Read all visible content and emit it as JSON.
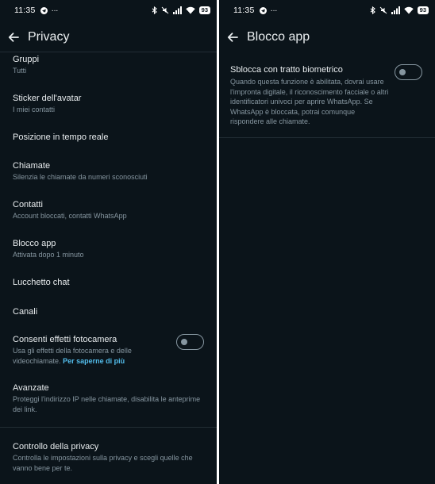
{
  "status_bar": {
    "time": "11:35",
    "overflow": "···",
    "battery": "93",
    "icons": [
      "telegram-icon",
      "bluetooth-icon",
      "mute-icon",
      "signal-icon",
      "wifi-icon",
      "battery-icon"
    ]
  },
  "left_screen": {
    "title": "Privacy",
    "items": [
      {
        "title": "Gruppi",
        "subtitle": "Tutti"
      },
      {
        "title": "Sticker dell'avatar",
        "subtitle": "I miei contatti"
      },
      {
        "title": "Posizione in tempo reale"
      },
      {
        "title": "Chiamate",
        "subtitle": "Silenzia le chiamate da numeri sconosciuti"
      },
      {
        "title": "Contatti",
        "subtitle": "Account bloccati, contatti WhatsApp"
      },
      {
        "title": "Blocco app",
        "subtitle": "Attivata dopo 1 minuto"
      },
      {
        "title": "Lucchetto chat"
      },
      {
        "title": "Canali"
      },
      {
        "title": "Consenti effetti fotocamera",
        "subtitle": "Usa gli effetti della fotocamera e delle videochiamate.",
        "link": "Per saperne di più",
        "toggle": "off"
      },
      {
        "title": "Avanzate",
        "subtitle": "Proteggi l'indirizzo IP nelle chiamate, disabilita le anteprime dei link."
      },
      {
        "title": "Controllo della privacy",
        "subtitle": "Controlla le impostazioni sulla privacy e scegli quelle che vanno bene per te."
      }
    ]
  },
  "right_screen": {
    "title": "Blocco app",
    "setting": {
      "title": "Sblocca con tratto biometrico",
      "description": "Quando questa funzione è abilitata, dovrai usare l'impronta digitale, il riconoscimento facciale o altri identificatori univoci per aprire WhatsApp. Se WhatsApp è bloccata, potrai comunque rispondere alle chiamate.",
      "toggle": "off"
    }
  },
  "colors": {
    "background": "#0b141a",
    "primary_text": "#e9edef",
    "secondary_text": "#8696a0",
    "link": "#53bdeb",
    "divider": "#222d34"
  }
}
